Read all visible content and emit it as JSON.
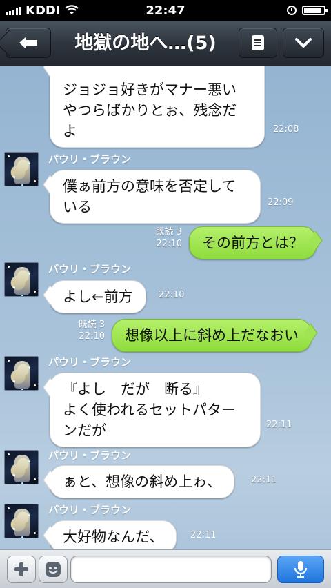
{
  "status_bar": {
    "carrier": "KDDI",
    "time": "22:47",
    "battery_level": 0.85
  },
  "header": {
    "title": "地獄の地へ…(5)",
    "back_icon": "arrow-left-icon",
    "menu_icon": "list-icon",
    "down_icon": "chevron-down-icon"
  },
  "messages": [
    {
      "side": "left",
      "sender": "",
      "text": "ジョジョ好きがマナー悪い\nやつらばかりとぉ、残念だ\nよ",
      "time": "22:08",
      "read": ""
    },
    {
      "side": "left",
      "sender": "パウリ・ブラウン",
      "text": "僕ぁ前方の意味を否定して\nいる",
      "time": "22:09",
      "read": ""
    },
    {
      "side": "right",
      "sender": "",
      "text": "その前方とは？",
      "time": "22:10",
      "read": "既読 3"
    },
    {
      "side": "left",
      "sender": "パウリ・ブラウン",
      "text": "よし←前方",
      "time": "22:10",
      "read": ""
    },
    {
      "side": "right",
      "sender": "",
      "text": "想像以上に斜め上だなおい",
      "time": "22:10",
      "read": "既読 3"
    },
    {
      "side": "left",
      "sender": "パウリ・ブラウン",
      "text": "『よし　だが　断る』\nよく使われるセットパター\nンだが",
      "time": "22:11",
      "read": ""
    },
    {
      "side": "left",
      "sender": "パウリ・ブラウン",
      "text": "ぁと、想像の斜め上ゎ、",
      "time": "22:11",
      "read": ""
    },
    {
      "side": "left",
      "sender": "パウリ・ブラウン",
      "text": "大好物なんだ、",
      "time": "22:11",
      "read": ""
    }
  ],
  "input_bar": {
    "placeholder": "",
    "add_icon": "plus-icon",
    "emoji_icon": "smiley-icon",
    "mic_icon": "microphone-icon"
  }
}
